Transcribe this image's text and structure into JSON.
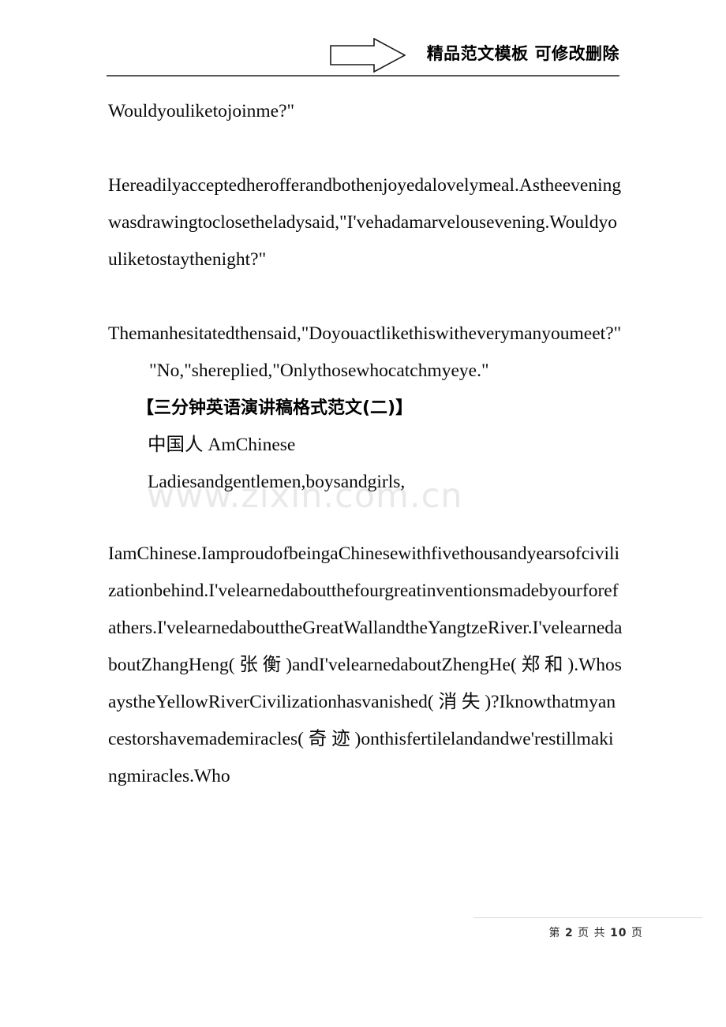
{
  "header": {
    "title": "精品范文模板 可修改删除",
    "arrow_icon": "right-block-arrow-icon"
  },
  "watermark": {
    "text": "www.zixin.com.cn"
  },
  "body": {
    "paragraph_1": "Wouldyouliketojoinme?\"",
    "paragraph_2": "Hereadilyacceptedherofferandbothenjoyedalovelymeal.Astheeveningwasdrawingtoclosetheladysaid,\"I'vehadamarvelousevening.Wouldyouliketostaythenight?\"",
    "paragraph_3": "Themanhesitatedthensaid,\"Doyouactlikethiswitheverymanyoumeet?\"",
    "quote_line": "\"No,\"shereplied,\"Onlythosewhocatchmyeye.\"",
    "heading_2": "【三分钟英语演讲稿格式范文(二)】",
    "subtitle_cn_en": "中国人 AmChinese",
    "salutation": "Ladiesandgentlemen,boysandgirls,",
    "paragraph_4": "IamChinese.IamproudofbeingaChinesewithfivethousandyearsofcivilizationbehind.I'velearnedaboutthefourgreatinventionsmadebyourforefathers.I'velearnedabouttheGreatWallandtheYangtzeRiver.I'velearnedaboutZhangHeng( 张 衡 )andI'velearnedaboutZhengHe( 郑 和 ).WhosaystheYellowRiverCivilizationhasvanished( 消 失 )?Iknowthatmyancestorshavemademiracles( 奇 迹 )onthisfertilelandandwe'restillmakingmiracles.Who"
  },
  "footer": {
    "prefix": "第",
    "current_page": "2",
    "middle": "页 共",
    "total_pages": "10",
    "suffix": "页"
  },
  "colors": {
    "header_rule": "#595959",
    "text": "#0a0a0a",
    "watermark": "#e9e9e9",
    "footer_rule": "#d8d8d8"
  }
}
